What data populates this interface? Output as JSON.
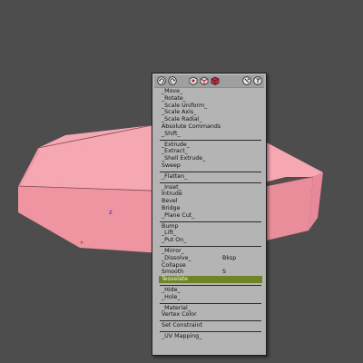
{
  "viewport": {
    "background_color": "#4d4d4d",
    "mesh_color": "#f09aa6",
    "center_marker": "z"
  },
  "menu": {
    "header_icons": [
      "rotate-left-icon",
      "rotate-right-icon",
      "vertex-select-icon",
      "edge-select-icon",
      "face-select-icon",
      "pin-icon",
      "help-icon"
    ],
    "items": [
      {
        "label": "_Move_",
        "shortcut": ""
      },
      {
        "label": "_Rotate_",
        "shortcut": ""
      },
      {
        "label": "_Scale Uniform_",
        "shortcut": ""
      },
      {
        "label": "_Scale Axis_",
        "shortcut": ""
      },
      {
        "label": "_Scale Radial_",
        "shortcut": ""
      },
      {
        "label": "Absolute Commands",
        "shortcut": ""
      },
      {
        "label": "_Shift_",
        "shortcut": ""
      },
      {
        "label": "_Extrude_",
        "shortcut": ""
      },
      {
        "label": "_Extract_",
        "shortcut": ""
      },
      {
        "label": "_Shell Extrude_",
        "shortcut": ""
      },
      {
        "label": "Sweep",
        "shortcut": ""
      },
      {
        "label": "_Flatten_",
        "shortcut": ""
      },
      {
        "label": "_Inset_",
        "shortcut": ""
      },
      {
        "label": "Intrude",
        "shortcut": ""
      },
      {
        "label": "Bevel",
        "shortcut": ""
      },
      {
        "label": "Bridge",
        "shortcut": ""
      },
      {
        "label": "_Plane Cut_",
        "shortcut": ""
      },
      {
        "label": "Bump",
        "shortcut": ""
      },
      {
        "label": "_Lift_",
        "shortcut": ""
      },
      {
        "label": "_Put On_",
        "shortcut": ""
      },
      {
        "label": "_Mirror_",
        "shortcut": ""
      },
      {
        "label": "_Dissolve_",
        "shortcut": "Bksp"
      },
      {
        "label": "Collapse",
        "shortcut": ""
      },
      {
        "label": "Smooth",
        "shortcut": "S"
      },
      {
        "label": "Tesselate",
        "shortcut": ""
      },
      {
        "label": "_Hide_",
        "shortcut": ""
      },
      {
        "label": "_Hole_",
        "shortcut": ""
      },
      {
        "label": "_Material_",
        "shortcut": ""
      },
      {
        "label": "Vertex Color",
        "shortcut": ""
      },
      {
        "label": "Set Constraint",
        "shortcut": ""
      },
      {
        "label": "_UV Mapping_",
        "shortcut": ""
      }
    ],
    "groups": [
      7,
      4,
      1,
      5,
      3,
      5,
      2,
      2,
      1,
      1
    ],
    "active_label": "Tesselate",
    "active_color": "#6f8425",
    "panel_color": "#b4b4b4"
  }
}
